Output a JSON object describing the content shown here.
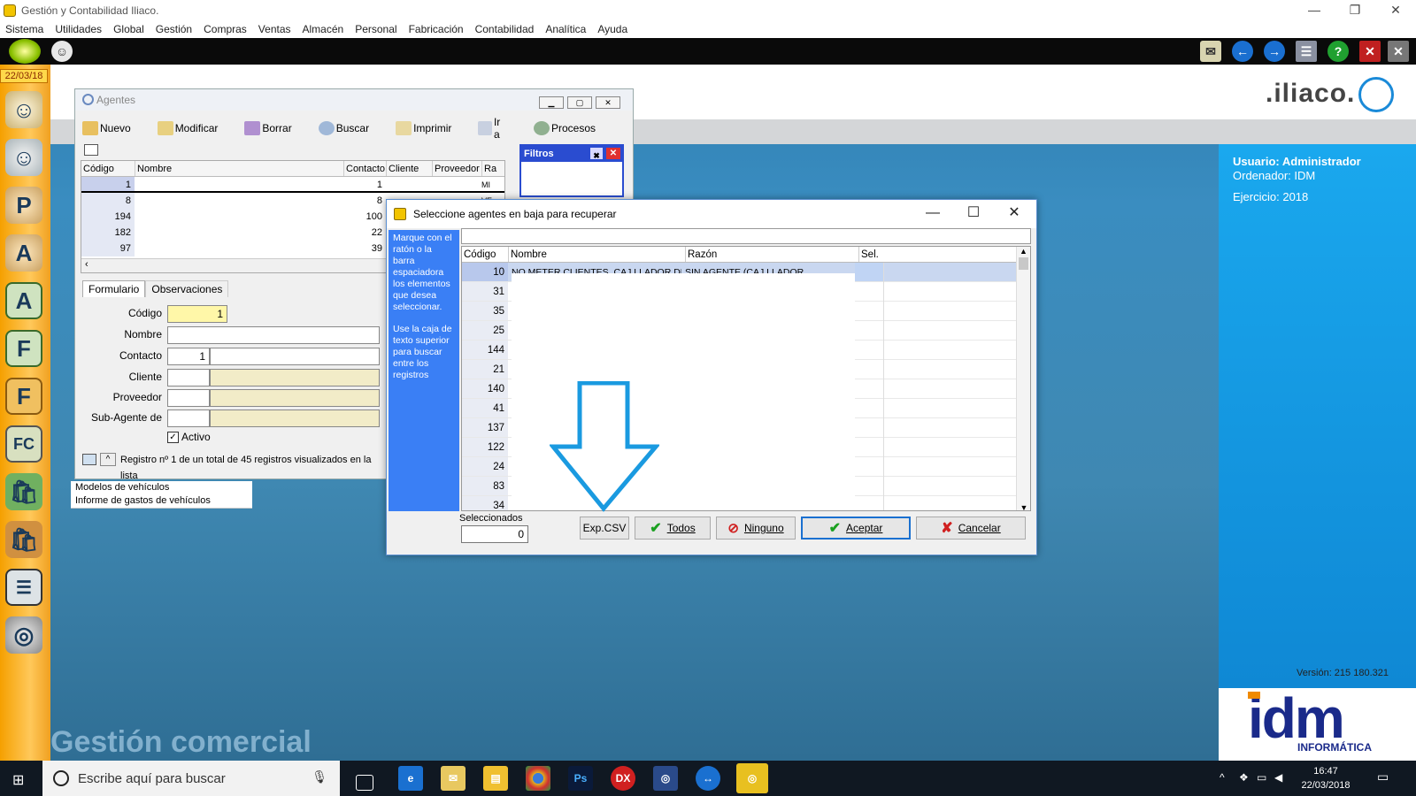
{
  "app": {
    "title": "Gestión y Contabilidad Iliaco.",
    "menu": [
      "Sistema",
      "Utilidades",
      "Global",
      "Gestión",
      "Compras",
      "Ventas",
      "Almacén",
      "Personal",
      "Fabricación",
      "Contabilidad",
      "Analítica",
      "Ayuda"
    ],
    "date": "22/03/18",
    "brand": ".iliaco.",
    "footer_title": "Gestión comercial"
  },
  "info": {
    "usuario": "Usuario: Administrador",
    "ordenador": "Ordenador: IDM",
    "ejercicio": "Ejercicio: 2018",
    "version": "Versión: 215 180.321",
    "idm_logo": "idm",
    "idm_sub": "INFORMÁTICA"
  },
  "submenus": [
    "Modelos de vehículos",
    "Informe de gastos de vehículos"
  ],
  "agentes": {
    "title": "Agentes",
    "toolbar": [
      "Nuevo",
      "Modificar",
      "Borrar",
      "Buscar",
      "Imprimir",
      "Ir a",
      "Procesos"
    ],
    "columns": [
      "Código",
      "Nombre",
      "Contacto",
      "Cliente",
      "Proveedor",
      "Ra"
    ],
    "rows": [
      {
        "codigo": "1",
        "contacto": "1",
        "ra": "MI"
      },
      {
        "codigo": "8",
        "contacto": "8",
        "ra": "VE"
      },
      {
        "codigo": "194",
        "contacto": "100",
        "ra": ""
      },
      {
        "codigo": "182",
        "contacto": "22",
        "ra": ""
      },
      {
        "codigo": "97",
        "contacto": "39",
        "ra": ""
      }
    ],
    "filtros": "Filtros",
    "tabs": [
      "Formulario",
      "Observaciones"
    ],
    "form": {
      "codigo_label": "Código",
      "codigo": "1",
      "nombre_label": "Nombre",
      "contacto_label": "Contacto",
      "contacto": "1",
      "cliente_label": "Cliente",
      "proveedor_label": "Proveedor",
      "subagente_label": "Sub-Agente de",
      "activo_label": "Activo"
    },
    "status": "Registro nº 1 de un total de 45 registros visualizados en la lista"
  },
  "dialog": {
    "title": "Seleccione agentes en baja para recuperar",
    "help1": "Marque con el ratón o la barra espaciadora los elementos que desea seleccionar.",
    "help2": "Use la caja de texto superior para buscar entre los registros",
    "columns": [
      "Código",
      "Nombre",
      "Razón",
      "Sel."
    ],
    "first_row": {
      "codigo": "10",
      "nombre": "NO METER CLIENTES, CAJ.LLADOR DE",
      "razon": "SIN AGENTE (CAJ.LLADOR"
    },
    "codes": [
      "31",
      "35",
      "25",
      "144",
      "21",
      "140",
      "41",
      "137",
      "122",
      "24",
      "83",
      "34"
    ],
    "seleccionados_label": "Seleccionados",
    "seleccionados": "0",
    "buttons": {
      "csv": "Exp.CSV",
      "todos": "Todos",
      "ninguno": "Ninguno",
      "aceptar": "Aceptar",
      "cancelar": "Cancelar"
    }
  },
  "taskbar": {
    "search_placeholder": "Escribe aquí para buscar",
    "time": "16:47",
    "date": "22/03/2018"
  }
}
